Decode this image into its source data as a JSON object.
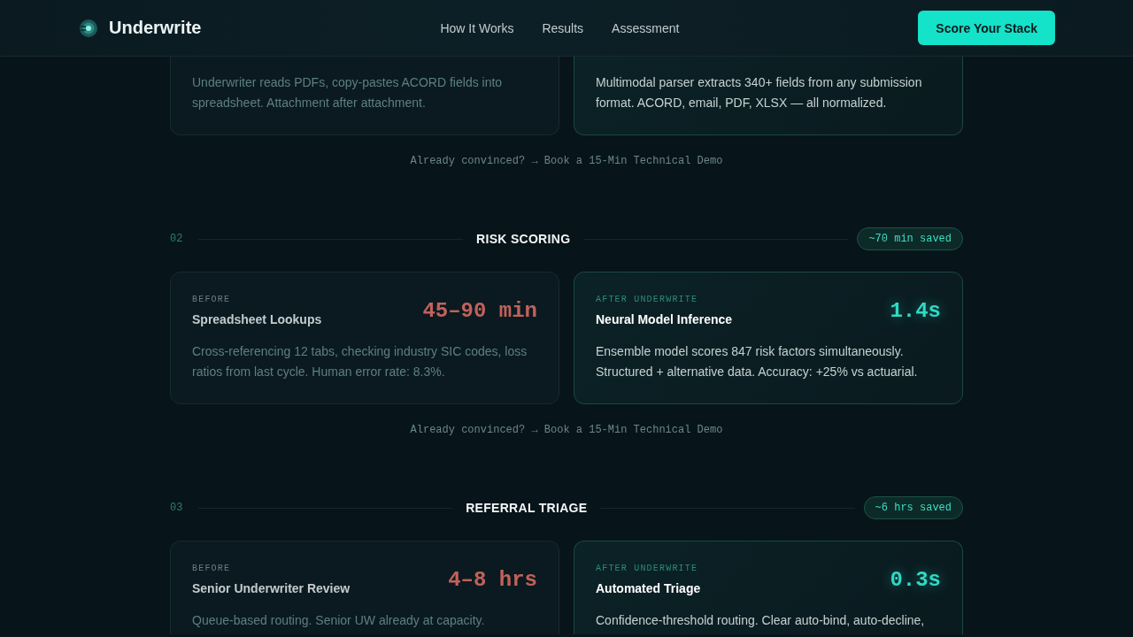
{
  "header": {
    "brand": "Underwrite",
    "nav": [
      "How It Works",
      "Results",
      "Assessment"
    ],
    "cta_button": "Score Your Stack"
  },
  "partial_section": {
    "cards": [
      {
        "kind": "before",
        "description": "Underwriter reads PDFs, copy-pastes ACORD fields into spreadsheet. Attachment after attachment."
      },
      {
        "kind": "after",
        "description": "Multimodal parser extracts 340+ fields from any submission format. ACORD, email, PDF, XLSX — all normalized."
      }
    ],
    "demo_link": "Already convinced? → Book a 15-Min Technical Demo"
  },
  "sections": [
    {
      "number": "02",
      "title": "RISK SCORING",
      "saved": "~70 min saved",
      "cards": [
        {
          "kind": "before",
          "label": "BEFORE",
          "title": "Spreadsheet Lookups",
          "metric": "45–90 min",
          "description": "Cross-referencing 12 tabs, checking industry SIC codes, loss ratios from last cycle. Human error rate: 8.3%."
        },
        {
          "kind": "after",
          "label": "AFTER UNDERWRITE",
          "title": "Neural Model Inference",
          "metric": "1.4s",
          "description": "Ensemble model scores 847 risk factors simultaneously. Structured + alternative data. Accuracy: +25% vs actuarial."
        }
      ],
      "demo_link": "Already convinced? → Book a 15-Min Technical Demo"
    },
    {
      "number": "03",
      "title": "REFERRAL TRIAGE",
      "saved": "~6 hrs saved",
      "cards": [
        {
          "kind": "before",
          "label": "BEFORE",
          "title": "Senior Underwriter Review",
          "metric": "4–8 hrs",
          "description": "Queue-based routing. Senior UW already at capacity."
        },
        {
          "kind": "after",
          "label": "AFTER UNDERWRITE",
          "title": "Automated Triage",
          "metric": "0.3s",
          "description": "Confidence-threshold routing. Clear auto-bind, auto-decline,"
        }
      ]
    }
  ]
}
